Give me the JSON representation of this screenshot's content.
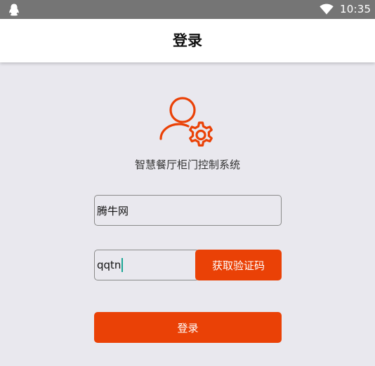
{
  "status_bar": {
    "time": "10:35",
    "left_icon": "qq-penguin-icon",
    "right_icon": "wifi-icon"
  },
  "header": {
    "title": "登录"
  },
  "logo": {
    "icon": "user-settings-icon",
    "color": "#ea4106"
  },
  "app": {
    "system_name": "智慧餐厅柜门控制系统"
  },
  "form": {
    "username_value": "腾牛网",
    "code_value": "qqtn",
    "get_code_label": "获取验证码",
    "login_label": "登录"
  },
  "colors": {
    "accent": "#ea4106",
    "background": "#e9e8ee",
    "status_bar": "#757575",
    "cursor": "#1aa694"
  }
}
